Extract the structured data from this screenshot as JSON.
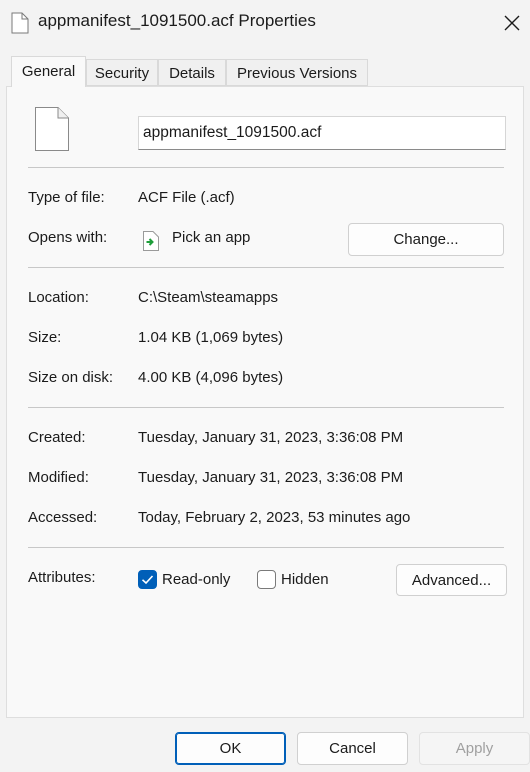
{
  "window": {
    "title": "appmanifest_1091500.acf Properties"
  },
  "tabs": [
    {
      "label": "General"
    },
    {
      "label": "Security"
    },
    {
      "label": "Details"
    },
    {
      "label": "Previous Versions"
    }
  ],
  "file": {
    "name": "appmanifest_1091500.acf",
    "icon": "document-icon"
  },
  "type_row": {
    "label": "Type of file:",
    "value": "ACF File (.acf)"
  },
  "opens_row": {
    "label": "Opens with:",
    "value": "Pick an app",
    "button": "Change...",
    "icon": "pick-app-icon"
  },
  "location_row": {
    "label": "Location:",
    "value": "C:\\Steam\\steamapps"
  },
  "size_row": {
    "label": "Size:",
    "value": "1.04 KB (1,069 bytes)"
  },
  "size_disk_row": {
    "label": "Size on disk:",
    "value": "4.00 KB (4,096 bytes)"
  },
  "created_row": {
    "label": "Created:",
    "value": "Tuesday, January 31, 2023, 3:36:08 PM"
  },
  "modified_row": {
    "label": "Modified:",
    "value": "Tuesday, January 31, 2023, 3:36:08 PM"
  },
  "accessed_row": {
    "label": "Accessed:",
    "value": "Today, February 2, 2023, 53 minutes ago"
  },
  "attributes": {
    "label": "Attributes:",
    "readonly_label": "Read-only",
    "readonly_checked": true,
    "hidden_label": "Hidden",
    "hidden_checked": false,
    "advanced_button": "Advanced..."
  },
  "footer": {
    "ok": "OK",
    "cancel": "Cancel",
    "apply": "Apply",
    "apply_disabled": true
  },
  "colors": {
    "accent": "#005fb8",
    "panel": "#f9f9f9",
    "window": "#f3f3f3"
  }
}
